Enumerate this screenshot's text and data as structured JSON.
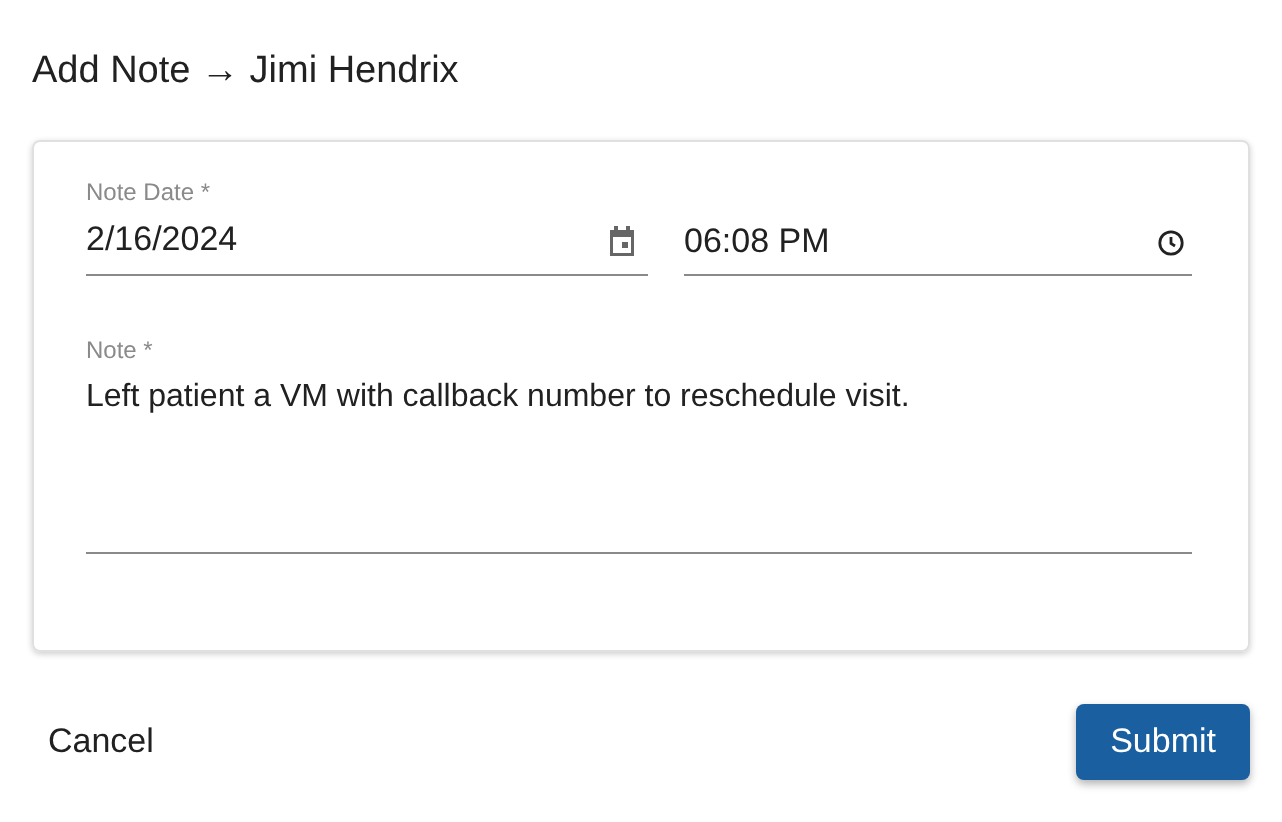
{
  "title": "Add Note → Jimi Hendrix",
  "form": {
    "date": {
      "label": "Note Date *",
      "value": "2/16/2024"
    },
    "time": {
      "value": "06:08 PM"
    },
    "note": {
      "label": "Note *",
      "value": "Left patient a VM with callback number to reschedule visit."
    }
  },
  "buttons": [
    {
      "kind": "text",
      "label": "Cancel"
    },
    {
      "kind": "primary",
      "label": "Submit"
    }
  ]
}
